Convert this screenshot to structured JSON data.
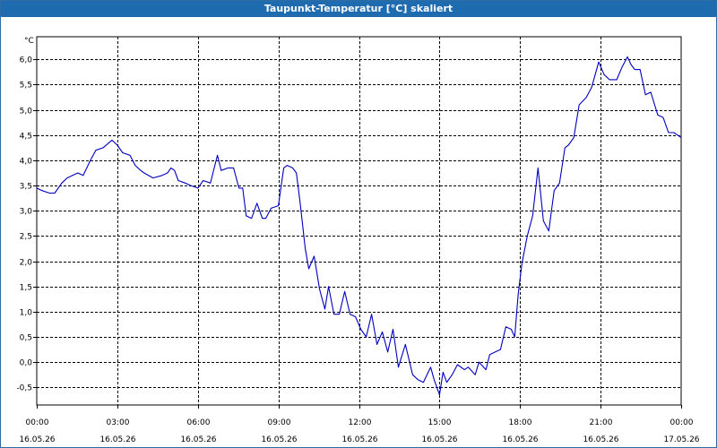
{
  "window": {
    "title": "Taupunkt-Temperatur [°C] skaliert"
  },
  "chart_data": {
    "type": "line",
    "title": "Taupunkt-Temperatur [°C] skaliert",
    "ylabel": "°C",
    "xlabel": "",
    "ylim": [
      -0.85,
      6.45
    ],
    "y_ticks": [
      6.0,
      5.5,
      5.0,
      4.5,
      4.0,
      3.5,
      3.0,
      2.5,
      2.0,
      1.5,
      1.0,
      0.5,
      0.0,
      -0.5
    ],
    "y_tick_labels": [
      "6,0",
      "5,5",
      "5,0",
      "4,5",
      "4,0",
      "3,5",
      "3,0",
      "2,5",
      "2,0",
      "1,5",
      "1,0",
      "0,5",
      "0,0",
      "-0,5"
    ],
    "x_range_hours": [
      0,
      24
    ],
    "x_ticks": [
      {
        "hour": 0,
        "time": "00:00",
        "date": "16.05.26"
      },
      {
        "hour": 3,
        "time": "03:00",
        "date": "16.05.26"
      },
      {
        "hour": 6,
        "time": "06:00",
        "date": "16.05.26"
      },
      {
        "hour": 9,
        "time": "09:00",
        "date": "16.05.26"
      },
      {
        "hour": 12,
        "time": "12:00",
        "date": "16.05.26"
      },
      {
        "hour": 15,
        "time": "15:00",
        "date": "16.05.26"
      },
      {
        "hour": 18,
        "time": "18:00",
        "date": "16.05.26"
      },
      {
        "hour": 21,
        "time": "21:00",
        "date": "16.05.26"
      },
      {
        "hour": 24,
        "time": "00:00",
        "date": "17.05.26"
      }
    ],
    "grid": true,
    "series": [
      {
        "color": "#0000c0",
        "x": [
          0.0,
          0.2,
          0.47,
          0.67,
          0.93,
          1.13,
          1.53,
          1.73,
          2.0,
          2.2,
          2.47,
          2.8,
          3.0,
          3.2,
          3.47,
          3.67,
          3.87,
          4.0,
          4.33,
          4.67,
          4.87,
          5.0,
          5.13,
          5.27,
          5.53,
          5.73,
          6.0,
          6.2,
          6.47,
          6.73,
          6.87,
          7.13,
          7.33,
          7.53,
          7.67,
          7.8,
          8.0,
          8.2,
          8.4,
          8.53,
          8.73,
          9.0,
          9.2,
          9.33,
          9.53,
          9.67,
          9.8,
          10.0,
          10.13,
          10.33,
          10.53,
          10.73,
          10.87,
          11.07,
          11.27,
          11.47,
          11.67,
          11.87,
          12.07,
          12.27,
          12.47,
          12.67,
          12.87,
          13.07,
          13.27,
          13.47,
          13.73,
          14.0,
          14.2,
          14.4,
          14.67,
          14.8,
          15.0,
          15.13,
          15.27,
          15.47,
          15.67,
          15.93,
          16.07,
          16.33,
          16.47,
          16.73,
          16.87,
          17.07,
          17.27,
          17.47,
          17.67,
          17.8,
          17.93,
          18.07,
          18.27,
          18.47,
          18.67,
          18.87,
          19.07,
          19.27,
          19.47,
          19.67,
          19.8,
          20.0,
          20.2,
          20.47,
          20.67,
          20.93,
          21.13,
          21.33,
          21.6,
          21.8,
          22.0,
          22.13,
          22.27,
          22.47,
          22.67,
          22.87,
          23.13,
          23.33,
          23.53,
          23.73,
          23.87,
          24.0
        ],
        "values": [
          3.45,
          3.4,
          3.35,
          3.35,
          3.55,
          3.65,
          3.75,
          3.7,
          4.0,
          4.2,
          4.25,
          4.4,
          4.3,
          4.15,
          4.1,
          3.9,
          3.8,
          3.75,
          3.65,
          3.7,
          3.75,
          3.85,
          3.8,
          3.6,
          3.55,
          3.5,
          3.45,
          3.6,
          3.55,
          4.1,
          3.8,
          3.85,
          3.85,
          3.45,
          3.45,
          2.9,
          2.85,
          3.15,
          2.85,
          2.85,
          3.05,
          3.1,
          3.85,
          3.9,
          3.85,
          3.75,
          3.2,
          2.25,
          1.85,
          2.1,
          1.45,
          1.05,
          1.5,
          0.95,
          0.95,
          1.4,
          0.95,
          0.9,
          0.65,
          0.5,
          0.95,
          0.35,
          0.6,
          0.2,
          0.65,
          -0.1,
          0.35,
          -0.25,
          -0.35,
          -0.4,
          -0.1,
          -0.35,
          -0.65,
          -0.2,
          -0.4,
          -0.25,
          -0.05,
          -0.15,
          -0.1,
          -0.25,
          0.0,
          -0.15,
          0.15,
          0.2,
          0.25,
          0.7,
          0.65,
          0.5,
          1.35,
          1.95,
          2.5,
          2.9,
          3.85,
          2.8,
          2.6,
          3.4,
          3.55,
          4.25,
          4.3,
          4.45,
          5.1,
          5.25,
          5.45,
          5.95,
          5.7,
          5.6,
          5.6,
          5.85,
          6.05,
          5.9,
          5.8,
          5.8,
          5.3,
          5.35,
          4.9,
          4.85,
          4.55,
          4.55,
          4.5,
          4.45
        ]
      }
    ]
  }
}
